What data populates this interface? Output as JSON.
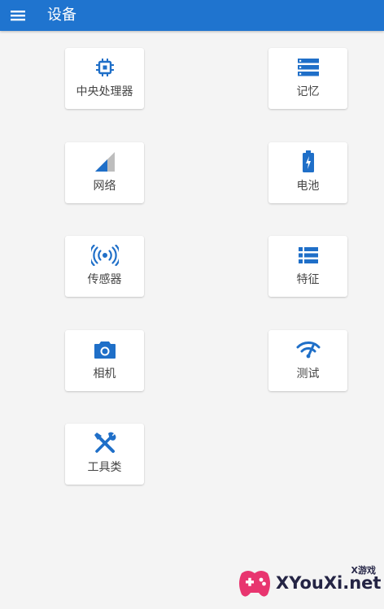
{
  "header": {
    "title": "设备",
    "menu_icon": "hamburger-menu-icon",
    "background": "#1f74cf"
  },
  "cards": [
    {
      "label": "中央处理器",
      "icon": "cpu-chip-icon"
    },
    {
      "label": "记忆",
      "icon": "memory-storage-icon"
    },
    {
      "label": "网络",
      "icon": "signal-strength-icon"
    },
    {
      "label": "电池",
      "icon": "battery-charging-icon"
    },
    {
      "label": "传感器",
      "icon": "sensor-waves-icon"
    },
    {
      "label": "特征",
      "icon": "feature-list-icon"
    },
    {
      "label": "相机",
      "icon": "camera-icon"
    },
    {
      "label": "测试",
      "icon": "wifi-test-icon"
    },
    {
      "label": "工具类",
      "icon": "tools-icon"
    }
  ],
  "accent_color": "#1f6fc8",
  "watermark": {
    "small_text": "X游戏",
    "big_text": "XYouXi.net"
  }
}
